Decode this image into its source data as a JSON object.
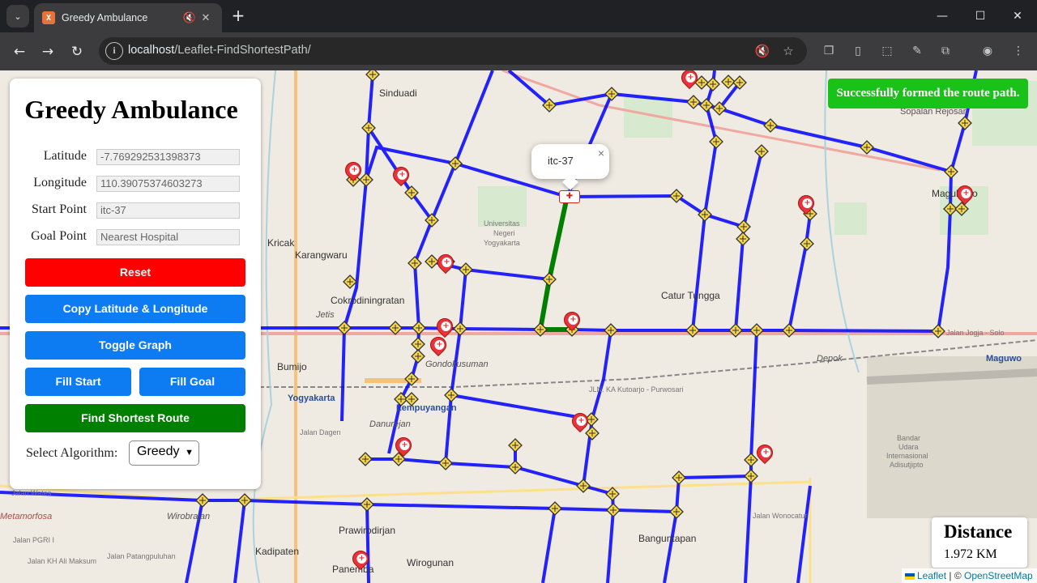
{
  "browser": {
    "tab_title": "Greedy Ambulance",
    "url_host": "localhost",
    "url_path": "/Leaflet-FindShortestPath/"
  },
  "panel": {
    "title": "Greedy Ambulance",
    "fields": {
      "latitude": {
        "label": "Latitude",
        "value": "-7.769292531398373"
      },
      "longitude": {
        "label": "Longitude",
        "value": "110.39075374603273"
      },
      "start": {
        "label": "Start Point",
        "value": "itc-37"
      },
      "goal": {
        "label": "Goal Point",
        "placeholder": "Nearest Hospital"
      }
    },
    "buttons": {
      "reset": "Reset",
      "copy": "Copy Latitude & Longitude",
      "toggle": "Toggle Graph",
      "fill_start": "Fill Start",
      "fill_goal": "Fill Goal",
      "find": "Find Shortest Route"
    },
    "algorithm_label": "Select Algorithm:",
    "algorithm_selected": "Greedy"
  },
  "popup": {
    "text": "itc-37",
    "close": "×"
  },
  "toast": "Successfully formed the route path.",
  "distance": {
    "title": "Distance",
    "value": "1.972 KM"
  },
  "attribution": {
    "leaflet": "Leaflet",
    "sep": " | © ",
    "osm": "OpenStreetMap"
  },
  "map_labels": {
    "sinduadi": "Sinduadi",
    "karangwaru": "Karangwaru",
    "kricak": "Kricak",
    "cokrodiningratan": "Cokrodiningratan",
    "bumijo": "Bumijo",
    "yogyakarta": "Yogyakarta",
    "lempuyangan": "Lempuyangan",
    "danurejan": "Danurejan",
    "gondokusuman": "Gondokusuman",
    "catur_tunggal": "Catur Tungga",
    "universitas": "Universitas",
    "negeri": "Negeri",
    "yogyakarta_u": "Yogyakarta",
    "maguharjo": "Maguharjo",
    "maguwo": "Maguwo",
    "sopalan": "Sopalan Rejosari",
    "prawirodirjan": "Prawirodirjan",
    "kadipaten": "Kadipaten",
    "wirogunan": "Wirogunan",
    "banguntapan": "Banguntapan",
    "panembahan": "Panemba",
    "wirobrajan": "Wirobrajan",
    "bandara": "Bandar",
    "bandara2": "Udara",
    "bandara3": "Internasional",
    "bandara4": "Adisutjipto",
    "jalan_jogja_solo": "Jalan Jogja - Solo",
    "jalan_wates": "Jalan Wates",
    "jalan_dagen": "Jalan Dagen",
    "jalan_kutoarjo": "JLN. KA Kutoarjo - Purwosari",
    "jalan_wonocatur": "Jalan Wonocatur",
    "jalan_patangpuluhan": "Jalan Patangpuluhan",
    "jalan_pgri": "Jalan PGRI I",
    "jalan_kh": "Jalan KH Ali Maksum",
    "metamorfosa": "Metamorfosa",
    "jetis": "Jetis",
    "depok": "Depok"
  }
}
